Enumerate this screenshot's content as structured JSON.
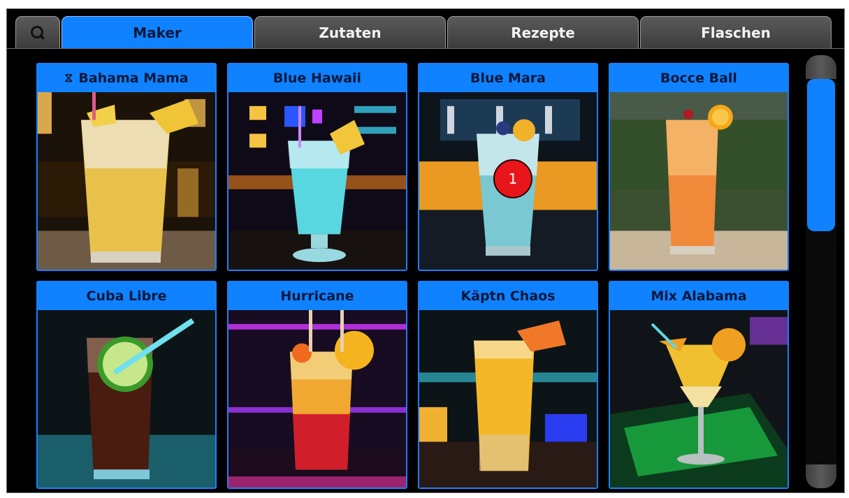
{
  "tabs": [
    {
      "id": "search",
      "label": ""
    },
    {
      "id": "maker",
      "label": "Maker",
      "active": true
    },
    {
      "id": "zutaten",
      "label": "Zutaten"
    },
    {
      "id": "rezepte",
      "label": "Rezepte"
    },
    {
      "id": "flaschen",
      "label": "Flaschen"
    }
  ],
  "cocktails": [
    {
      "name": "Bahama Mama",
      "icon": "hourglass-icon",
      "icon_glyph": "⧖"
    },
    {
      "name": "Blue Hawaii"
    },
    {
      "name": "Blue Mara"
    },
    {
      "name": "Bocce Ball"
    },
    {
      "name": "Cuba Libre"
    },
    {
      "name": "Hurricane"
    },
    {
      "name": "Käptn Chaos"
    },
    {
      "name": "Mix Alabama"
    }
  ],
  "badge": {
    "label": "1"
  },
  "colors": {
    "accent": "#1082ff",
    "badge": "#e8161b",
    "background": "#000000"
  }
}
